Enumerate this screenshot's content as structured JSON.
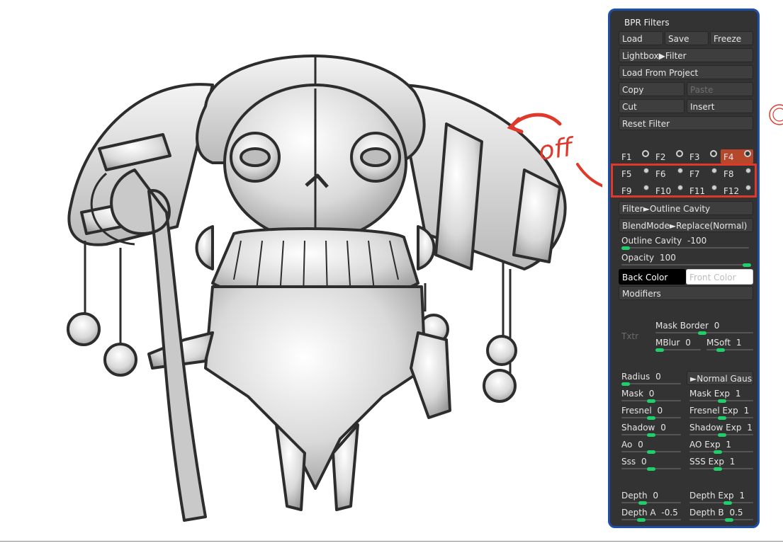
{
  "panel": {
    "title": "BPR Filters",
    "load": "Load",
    "save": "Save",
    "freeze": "Freeze",
    "lightbox_filter": "Lightbox▶Filter",
    "load_from_project": "Load From Project",
    "copy": "Copy",
    "paste": "Paste",
    "cut": "Cut",
    "insert": "Insert",
    "reset_filter": "Reset Filter",
    "slots": [
      "F1",
      "F2",
      "F3",
      "F4",
      "F5",
      "F6",
      "F7",
      "F8",
      "F9",
      "F10",
      "F11",
      "F12"
    ],
    "selected_slot": "F4",
    "filter_button": "Filter►Outline Cavity",
    "blendmode_button": "BlendMode►Replace(Normal)",
    "outline_cavity": {
      "label": "Outline Cavity",
      "value": "-100"
    },
    "opacity": {
      "label": "Opacity",
      "value": "100"
    },
    "back_color": "Back Color",
    "front_color": "Front Color",
    "modifiers": "Modifiers",
    "txtr": "Txtr",
    "mask_border": {
      "label": "Mask Border",
      "value": "0"
    },
    "mblur": {
      "label": "MBlur",
      "value": "0"
    },
    "msoft": {
      "label": "MSoft",
      "value": "1"
    },
    "radius": {
      "label": "Radius",
      "value": "0"
    },
    "normal_gauss": "►Normal Gauss",
    "mask": {
      "label": "Mask",
      "value": "0"
    },
    "mask_exp": {
      "label": "Mask Exp",
      "value": "1"
    },
    "fresnel": {
      "label": "Fresnel",
      "value": "0"
    },
    "fresnel_exp": {
      "label": "Fresnel Exp",
      "value": "1"
    },
    "shadow": {
      "label": "Shadow",
      "value": "0"
    },
    "shadow_exp": {
      "label": "Shadow Exp",
      "value": "1"
    },
    "ao": {
      "label": "Ao",
      "value": "0"
    },
    "ao_exp": {
      "label": "AO Exp",
      "value": "1"
    },
    "sss": {
      "label": "Sss",
      "value": "0"
    },
    "sss_exp": {
      "label": "SSS Exp",
      "value": "1"
    },
    "depth": {
      "label": "Depth",
      "value": "0"
    },
    "depth_exp": {
      "label": "Depth Exp",
      "value": "1"
    },
    "depth_a": {
      "label": "Depth A",
      "value": "-0.5"
    },
    "depth_b": {
      "label": "Depth B",
      "value": "0.5"
    }
  },
  "annotation": {
    "text": "off"
  },
  "colors": {
    "accent": "#1fcf6a",
    "selected_slot": "#b6472a",
    "annotation": "#e0392c",
    "panel_border": "#1e4fa8"
  }
}
